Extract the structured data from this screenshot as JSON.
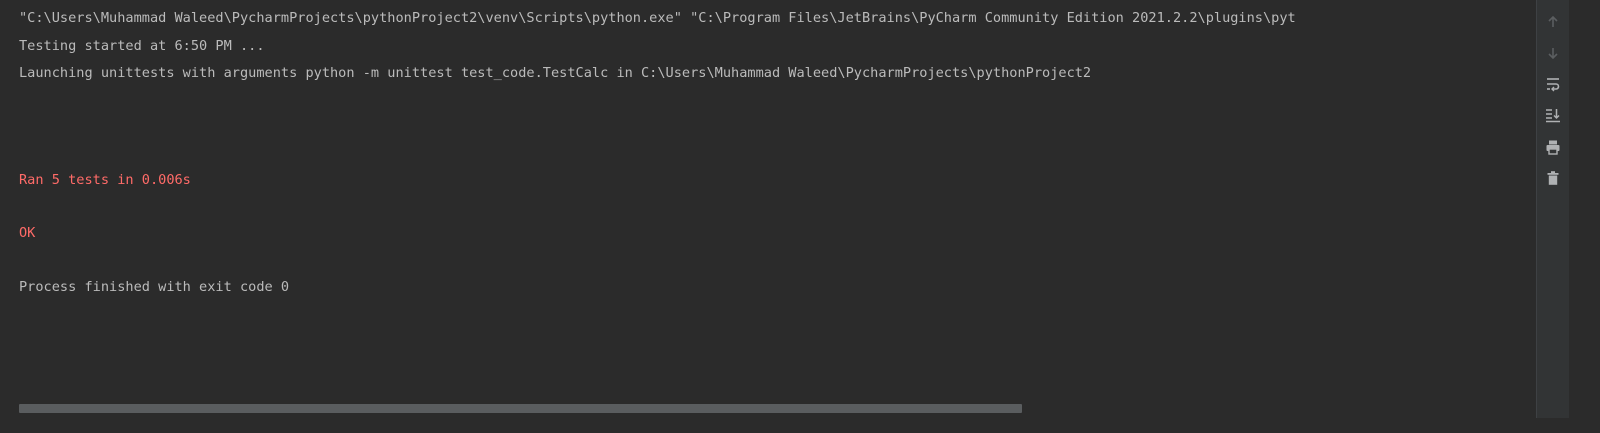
{
  "console": {
    "lines": [
      {
        "text": "\"C:\\Users\\Muhammad Waleed\\PycharmProjects\\pythonProject2\\venv\\Scripts\\python.exe\" \"C:\\Program Files\\JetBrains\\PyCharm Community Edition 2021.2.2\\plugins\\pyt",
        "kind": "normal"
      },
      {
        "text": "Testing started at 6:50 PM ...",
        "kind": "normal"
      },
      {
        "text": "Launching unittests with arguments python -m unittest test_code.TestCalc in C:\\Users\\Muhammad Waleed\\PycharmProjects\\pythonProject2",
        "kind": "normal"
      },
      {
        "text": "Ran 5 tests in 0.006s",
        "kind": "error"
      },
      {
        "text": "OK",
        "kind": "error"
      },
      {
        "text": "Process finished with exit code 0",
        "kind": "normal"
      }
    ]
  },
  "toolbar": {
    "buttons": [
      {
        "name": "up-arrow-icon",
        "label": "Up the Stack Trace",
        "enabled": false
      },
      {
        "name": "down-arrow-icon",
        "label": "Down the Stack Trace",
        "enabled": false
      },
      {
        "name": "soft-wrap-icon",
        "label": "Soft-Wrap",
        "enabled": true
      },
      {
        "name": "scroll-to-end-icon",
        "label": "Scroll to the End",
        "enabled": true
      },
      {
        "name": "print-icon",
        "label": "Print",
        "enabled": true
      },
      {
        "name": "trash-icon",
        "label": "Clear All",
        "enabled": true
      }
    ]
  },
  "colors": {
    "background": "#2b2b2b",
    "text": "#bbbbbb",
    "error_text": "#ff6b68",
    "icon": "#afb1b3",
    "icon_disabled": "#5b5e60"
  }
}
